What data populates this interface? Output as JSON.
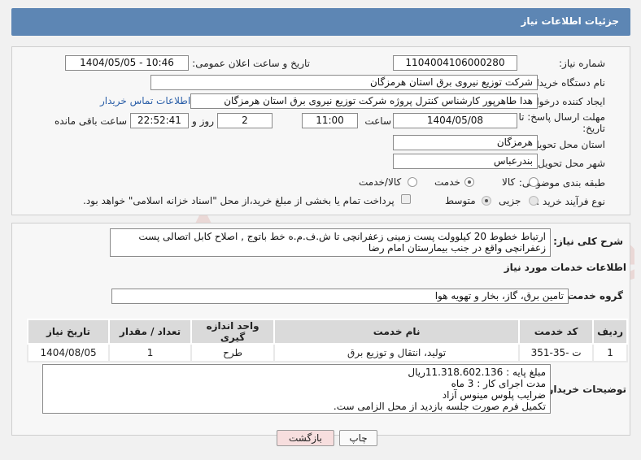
{
  "header": {
    "title": "جزئیات اطلاعات نیاز"
  },
  "form": {
    "need_number": {
      "label": "شماره نیاز:",
      "value": "1104004106000280"
    },
    "announce_datetime": {
      "label": "تاریخ و ساعت اعلان عمومی:",
      "value": "1404/05/05 - 10:46"
    },
    "buyer_org": {
      "label": "نام دستگاه خریدار:",
      "value": "شرکت توزیع نیروی برق استان هرمزگان"
    },
    "requester": {
      "label": "ایجاد کننده درخواست:",
      "value": "هدا طاهرپور کارشناس کنترل پروژه شرکت توزیع نیروی برق استان هرمزگان"
    },
    "contact_link": "اطلاعات تماس خریدار",
    "deadline": {
      "label": "مهلت ارسال پاسخ: تا تاریخ:",
      "date": "1404/05/08",
      "time_label": "ساعت",
      "time": "11:00",
      "days": "2",
      "days_label": "روز و",
      "remaining": "22:52:41",
      "remaining_label": "ساعت باقی مانده"
    },
    "province": {
      "label": "استان محل تحویل:",
      "value": "هرمزگان"
    },
    "city": {
      "label": "شهر محل تحویل:",
      "value": "بندرعباس"
    },
    "category": {
      "label": "طبقه بندی موضوعی:",
      "options": [
        "کالا",
        "خدمت",
        "کالا/خدمت"
      ],
      "selected": "خدمت"
    },
    "process": {
      "label": "نوع فرآیند خرید :",
      "options": [
        "جزیی",
        "متوسط"
      ],
      "selected": "متوسط",
      "payment_note": "پرداخت تمام یا بخشی از مبلغ خرید،از محل \"اسناد خزانه اسلامی\" خواهد بود."
    }
  },
  "summary": {
    "label": "شرح کلی نیاز:",
    "text": "ارتباط خطوط 20 کیلوولت پست زمینی زعفرانچی تا ش.ف.م.ه خط باتوج ,  اصلاح کابل اتصالی پست زعفرانچی واقع در جنب بیمارستان امام رضا"
  },
  "services": {
    "section_title": "اطلاعات خدمات مورد نیاز",
    "group_label": "گروه خدمت:",
    "group_value": "تامین برق، گاز، بخار و تهویه هوا",
    "columns": [
      "ردیف",
      "کد خدمت",
      "نام خدمت",
      "واحد اندازه گیری",
      "تعداد / مقدار",
      "تاریخ نیاز"
    ],
    "rows": [
      [
        "1",
        "ت -35-351",
        "تولید، انتقال و توزیع برق",
        "طرح",
        "1",
        "1404/08/05"
      ]
    ]
  },
  "buyer_notes": {
    "label": "توضیحات خریدار:",
    "lines": [
      "مبلغ پایه : 11.318.602.136ریال",
      "مدت اجرای کار : 3 ماه",
      "ضرایب پلوس مینوس آزاد",
      "تکمیل فرم صورت جلسه بازدید از محل الزامی ست."
    ]
  },
  "buttons": {
    "print": "چاپ",
    "back": "بازگشت"
  },
  "watermark": {
    "text": "AriaTender.neT"
  },
  "colors": {
    "header": "#5d86b4",
    "back_button": "#f7dede",
    "watermark": "#c0392b"
  }
}
